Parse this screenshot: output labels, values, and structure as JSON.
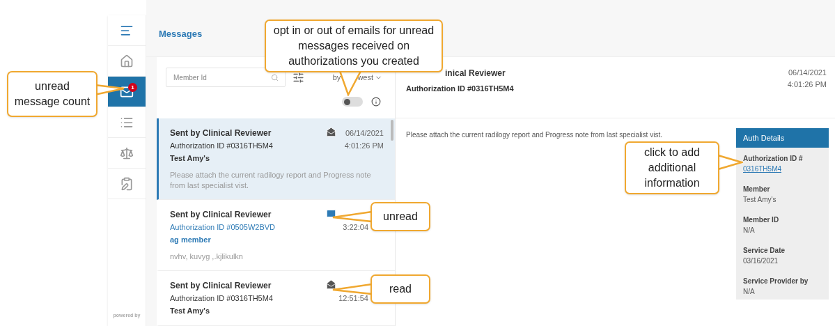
{
  "sidebar": {
    "items": [
      {
        "kind": "menu",
        "selected": false
      },
      {
        "kind": "home",
        "selected": false
      },
      {
        "kind": "messages",
        "selected": true,
        "badge": "1"
      },
      {
        "kind": "list",
        "selected": false
      },
      {
        "kind": "scales",
        "selected": false
      },
      {
        "kind": "clipboard",
        "selected": false
      }
    ],
    "footer": "powered by"
  },
  "header": {
    "title": "Messages"
  },
  "list": {
    "search": {
      "placeholder": "Member Id"
    },
    "sort": {
      "prefix": "by",
      "suffix": "west"
    },
    "email_toggle": {
      "on": false
    },
    "messages": [
      {
        "sender": "Sent by Clinical Reviewer",
        "auth_id": "Authorization ID #0316TH5M4",
        "member": "Test Amy's",
        "snippet": "Please attach the current radilogy report and Progress note from last specialist vist.",
        "date": "06/14/2021",
        "time": "4:01:26 PM",
        "read": true,
        "selected": true
      },
      {
        "sender": "Sent by Clinical Reviewer",
        "auth_id": "Authorization ID #0505W2BVD",
        "member": "ag member",
        "snippet": "nvhv, kuvyg ,.kjlikulkn",
        "time": "3:22:04",
        "read": false,
        "selected": false
      },
      {
        "sender": "Sent by Clinical Reviewer",
        "auth_id": "Authorization ID #0316TH5M4",
        "member": "Test Amy's",
        "time": "12:51:54",
        "read": true,
        "selected": false
      }
    ]
  },
  "detail": {
    "title": "inical Reviewer",
    "auth_id": "Authorization ID #0316TH5M4",
    "date": "06/14/2021",
    "time": "4:01:26 PM",
    "body": "Please attach the current radilogy report and Progress note from last specialist vist.",
    "auth_details": {
      "title": "Auth Details",
      "fields": [
        {
          "label": "Authorization ID #",
          "value": "0316TH5M4",
          "kind": "link"
        },
        {
          "label": "Member",
          "value": "Test Amy's",
          "kind": "text"
        },
        {
          "label": "Member ID",
          "value": "N/A",
          "kind": "text"
        },
        {
          "label": "Service Date",
          "value": "03/16/2021",
          "kind": "text"
        },
        {
          "label": "Service Provider by",
          "value": "N/A",
          "kind": "text"
        }
      ]
    }
  },
  "callouts": [
    {
      "text": "unread message count"
    },
    {
      "text": "opt in or out of emails for unread messages received on authorizations you created"
    },
    {
      "text": "unread"
    },
    {
      "text": "read"
    },
    {
      "text": "click to add additional information"
    }
  ]
}
